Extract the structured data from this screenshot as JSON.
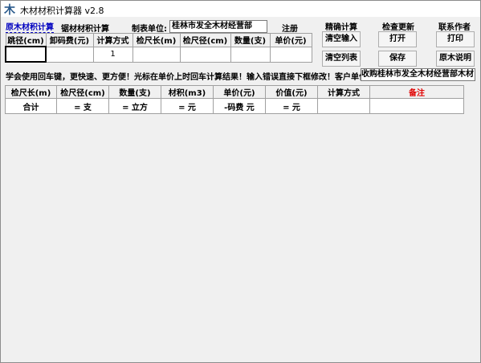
{
  "window": {
    "title": "木材材积计算器 v2.8",
    "icon_char": "木"
  },
  "tabs": {
    "raw": "原木材积计算",
    "sawn": "锯材材积计算"
  },
  "header": {
    "unit_label": "制表单位:",
    "unit_value": "桂林市发全木材经营部",
    "register": "注册",
    "precise_calc": "精确计算",
    "check_update": "检查更新",
    "contact_author": "联系作者"
  },
  "buttons": {
    "clear_input": "清空输入",
    "open": "打开",
    "print": "打印",
    "clear_list": "清空列表",
    "save": "保存",
    "raw_help": "原木说明"
  },
  "input_table": {
    "headers": [
      "跳径(cm)",
      "卸码费(元)",
      "计算方式",
      "检尺长(m)",
      "检尺径(cm)",
      "数量(支)",
      "单价(元)"
    ],
    "values": [
      "",
      "",
      "1",
      "",
      "",
      "",
      ""
    ]
  },
  "message": "学会使用回车键，更快速、更方便！光标在单价上时回车计算结果！输入错误直接下框修改！客户单位:",
  "customer_value": "收购桂林市发全木材经营部木材",
  "result_table": {
    "headers": [
      "检尺长(m)",
      "检尺径(cm)",
      "数量(支)",
      "材积(m3)",
      "单价(元)",
      "价值(元)",
      "计算方式",
      "备注"
    ],
    "total_row": [
      "合计",
      "= 支",
      "= 立方",
      "= 元",
      "-码费 元",
      "= 元",
      "",
      ""
    ]
  },
  "colors": {
    "remark_header": "#e00000",
    "tab_active": "#0000c0"
  }
}
